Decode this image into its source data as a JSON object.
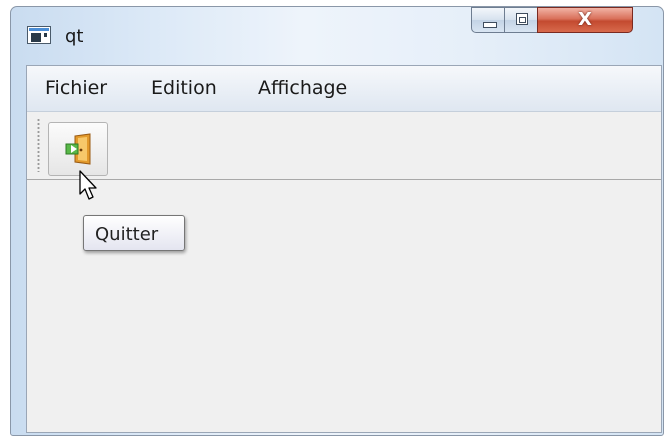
{
  "window": {
    "title": "qt",
    "controls": {
      "minimize": "minimize",
      "maximize": "maximize",
      "close_label": "X"
    }
  },
  "menubar": {
    "items": [
      {
        "label": "Fichier"
      },
      {
        "label": "Edition"
      },
      {
        "label": "Affichage"
      }
    ]
  },
  "toolbar": {
    "actions": [
      {
        "icon": "exit-door-icon",
        "tooltip": "Quitter"
      }
    ]
  },
  "tooltip": {
    "text": "Quitter"
  },
  "colors": {
    "close_button": "#c34a30",
    "menubar_bg": "#dfe7f1",
    "client_bg": "#f0f0f0"
  }
}
